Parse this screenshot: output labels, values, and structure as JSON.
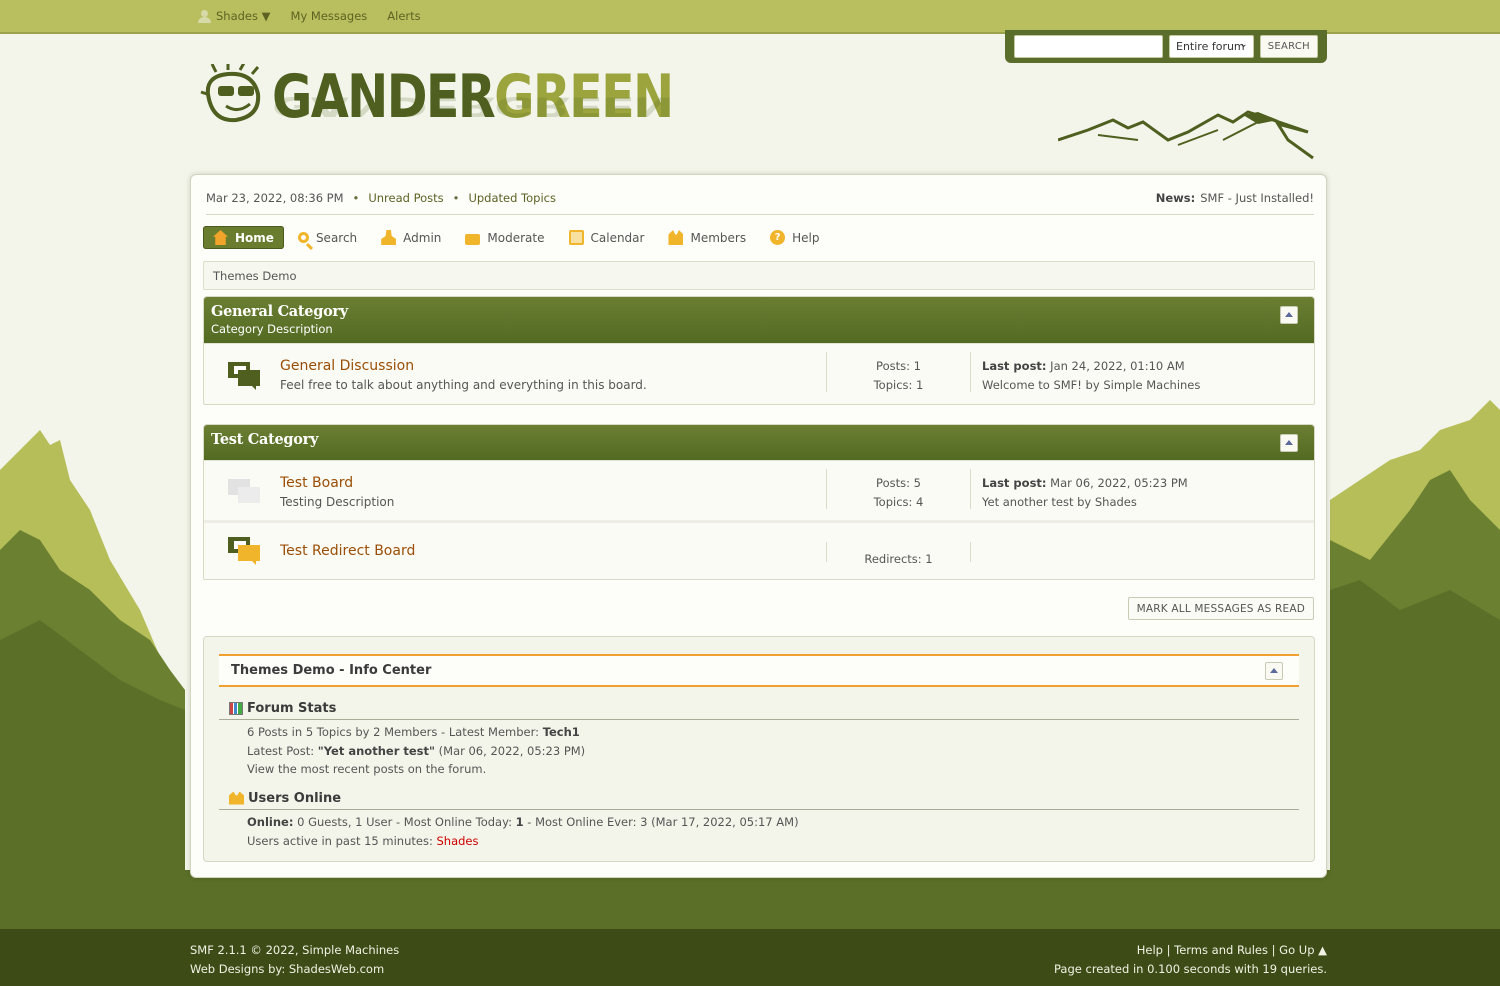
{
  "topbar": {
    "user": "Shades ▼",
    "messages": "My Messages",
    "alerts": "Alerts"
  },
  "search": {
    "scope": "Entire forum",
    "button": "SEARCH",
    "value": ""
  },
  "logo": {
    "part1": "GANDER",
    "part2": "GREEN"
  },
  "upper": {
    "datetime": "Mar 23, 2022, 08:36 PM",
    "sep": "•",
    "unread": "Unread Posts",
    "updated": "Updated Topics",
    "news_label": "News:",
    "news_text": "SMF - Just Installed!"
  },
  "menu": {
    "home": "Home",
    "search": "Search",
    "admin": "Admin",
    "moderate": "Moderate",
    "calendar": "Calendar",
    "members": "Members",
    "help": "Help"
  },
  "linktree": "Themes Demo",
  "categories": [
    {
      "title": "General Category",
      "description": "Category Description",
      "boards": [
        {
          "name": "General Discussion",
          "description": "Feel free to talk about anything and everything in this board.",
          "posts": "Posts: 1",
          "topics": "Topics: 1",
          "last_label": "Last post:",
          "last_date": "Jan 24, 2022, 01:10 AM",
          "last_topic": "Welcome to SMF! by Simple Machines"
        }
      ]
    },
    {
      "title": "Test Category",
      "description": "",
      "boards": [
        {
          "name": "Test Board",
          "description": "Testing Description",
          "posts": "Posts: 5",
          "topics": "Topics: 4",
          "last_label": "Last post:",
          "last_date": "Mar 06, 2022, 05:23 PM",
          "last_topic": "Yet another test by Shades"
        },
        {
          "name": "Test Redirect Board",
          "redirects": "Redirects: 1"
        }
      ]
    }
  ],
  "mark_read": "MARK ALL MESSAGES AS READ",
  "info_center": {
    "title": "Themes Demo - Info Center",
    "stats_title": "Forum Stats",
    "stats_line1_pre": "6 Posts in 5 Topics by 2 Members - Latest Member: ",
    "stats_line1_member": "Tech1",
    "stats_line2_pre": "Latest Post: ",
    "stats_line2_post": "\"Yet another test\"",
    "stats_line2_date": " (Mar 06, 2022, 05:23 PM)",
    "stats_line3": "View the most recent posts on the forum.",
    "online_title": "Users Online",
    "online_label": "Online:",
    "online_text": " 0 Guests, 1 User  - Most Online Today: ",
    "online_today": "1",
    "online_ever": " -  Most Online Ever: 3 (Mar 17, 2022, 05:17 AM)",
    "active_pre": "Users active in past 15 minutes: ",
    "active_user": "Shades"
  },
  "footer": {
    "copyright": "SMF 2.1.1 © 2022, Simple Machines",
    "designs": "Web Designs by: ShadesWeb.com",
    "help": "Help",
    "sep": "|",
    "terms": "Terms and Rules",
    "goup": "Go Up ▲",
    "generated": "Page created in 0.100 seconds with 19 queries."
  },
  "colors": {
    "topbar": "#b9bf5e",
    "category_header": "#5d7127",
    "board_link": "#9a4e05",
    "accent_orange": "#f0a030",
    "footer": "#3d4c16"
  }
}
